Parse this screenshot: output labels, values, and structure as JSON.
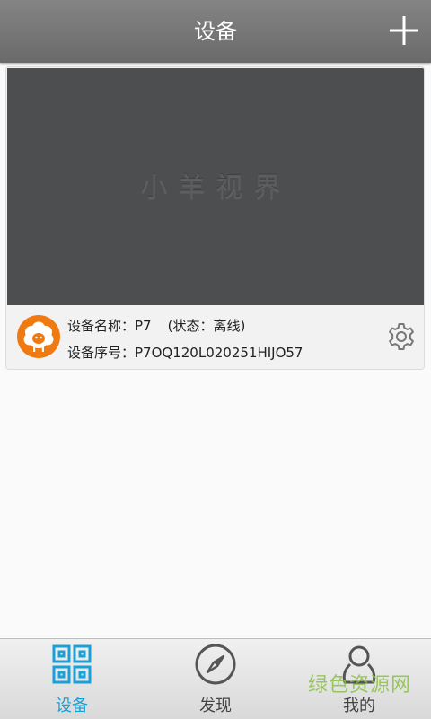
{
  "header": {
    "title": "设备",
    "add_icon": "plus-icon"
  },
  "device_card": {
    "preview_watermark": "小羊视界",
    "name_label": "设备名称：P7",
    "status_label": "(状态：离线)",
    "serial_label": "设备序号：P7OQ120L020251HIJO57",
    "avatar_icon": "sheep-avatar-icon",
    "settings_icon": "gear-icon"
  },
  "tabs": [
    {
      "label": "设备",
      "icon": "device-grid-icon",
      "active": true
    },
    {
      "label": "发现",
      "icon": "compass-icon",
      "active": false
    },
    {
      "label": "我的",
      "icon": "person-icon",
      "active": false
    }
  ],
  "brand_watermark": "绿色资源网",
  "colors": {
    "active": "#1aa0d8",
    "inactive": "#444444",
    "avatar": "#ef7a12"
  }
}
